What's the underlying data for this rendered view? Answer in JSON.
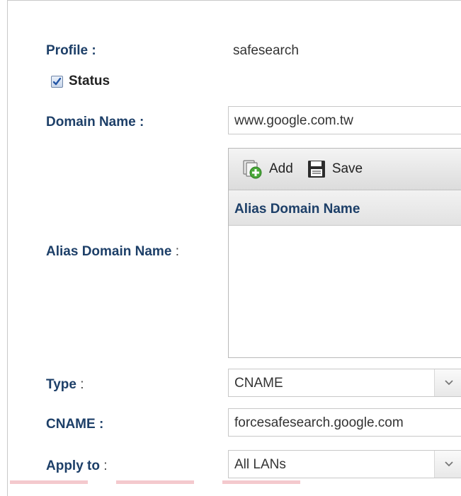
{
  "profile": {
    "label": "Profile :",
    "value": "safesearch"
  },
  "status": {
    "label": "Status",
    "checked": true
  },
  "domain_name": {
    "label": "Domain Name :",
    "value": "www.google.com.tw"
  },
  "alias_domain": {
    "label": "Alias Domain Name",
    "colon": ":",
    "toolbar": {
      "add_label": "Add",
      "save_label": "Save"
    },
    "column_header": "Alias Domain Name",
    "rows": []
  },
  "type": {
    "label": "Type",
    "colon": ":",
    "selected": "CNAME"
  },
  "cname": {
    "label": "CNAME :",
    "value": "forcesafesearch.google.com"
  },
  "apply_to": {
    "label": "Apply to",
    "colon": ":",
    "selected": "All LANs"
  },
  "icons": {
    "checkbox": "checkmark-icon",
    "add": "add-icon",
    "save": "save-icon",
    "dropdown": "chevron-down-icon"
  },
  "colors": {
    "label": "#1d3f68",
    "text": "#333333",
    "border": "#c8c8c8",
    "add_icon": "#49a83a"
  }
}
